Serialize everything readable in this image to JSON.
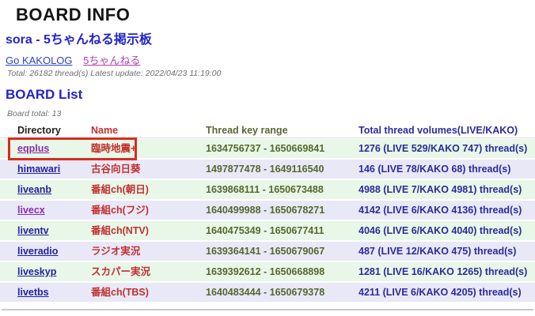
{
  "header": {
    "title": "BOARD INFO",
    "subtitle": "sora - 5ちゃんねる掲示板",
    "links": [
      {
        "label": "Go KAKOLOG"
      },
      {
        "label": "5ちゃんねる"
      }
    ],
    "total_line": "Total: 26182 thread(s) Latest update: 2022/04/23 11:19:00"
  },
  "list": {
    "title": "BOARD List",
    "board_total_line": "Board total: 13"
  },
  "table": {
    "headers": [
      "Directory",
      "Name",
      "Thread key range",
      "Total thread volumes(LIVE/KAKO)"
    ],
    "rows": [
      {
        "directory": "eqplus",
        "name": "臨時地震+",
        "range": "1634756737 - 1650669841",
        "volumes": "1276 (LIVE 529/KAKO 747) thread(s)",
        "visited": true,
        "highlighted": true
      },
      {
        "directory": "himawari",
        "name": "古谷向日葵",
        "range": "1497877478 - 1649116540",
        "volumes": "146 (LIVE 78/KAKO 68) thread(s)",
        "visited": false,
        "highlighted": false
      },
      {
        "directory": "liveanb",
        "name": "番組ch(朝日)",
        "range": "1639868111 - 1650673488",
        "volumes": "4988 (LIVE 7/KAKO 4981) thread(s)",
        "visited": false,
        "highlighted": false
      },
      {
        "directory": "livecx",
        "name": "番組ch(フジ)",
        "range": "1640499988 - 1650678271",
        "volumes": "4142 (LIVE 6/KAKO 4136) thread(s)",
        "visited": true,
        "highlighted": false
      },
      {
        "directory": "liventv",
        "name": "番組ch(NTV)",
        "range": "1640475349 - 1650677411",
        "volumes": "4046 (LIVE 6/KAKO 4040) thread(s)",
        "visited": false,
        "highlighted": false
      },
      {
        "directory": "liveradio",
        "name": "ラジオ実況",
        "range": "1639364141 - 1650679067",
        "volumes": "487 (LIVE 12/KAKO 475) thread(s)",
        "visited": false,
        "highlighted": false
      },
      {
        "directory": "liveskyp",
        "name": "スカパー実況",
        "range": "1639392612 - 1650668898",
        "volumes": "1281 (LIVE 16/KAKO 1265) thread(s)",
        "visited": false,
        "highlighted": false
      },
      {
        "directory": "livetbs",
        "name": "番組ch(TBS)",
        "range": "1640483444 - 1650679378",
        "volumes": "4211 (LIVE 6/KAKO 4205) thread(s)",
        "visited": false,
        "highlighted": false
      }
    ]
  },
  "colors": {
    "heading_blue": "#2424c9",
    "link_blue": "#2b45c4",
    "visited_magenta": "#b13fb1",
    "dir_link_navy": "#22229d",
    "dir_link_visited": "#8b2da8",
    "name_red": "#c22f2f",
    "range_olive": "#55682f",
    "volumes_navy": "#2b2b9b",
    "row_green": "#e8f7e8",
    "row_lavender": "#e8e8f7",
    "highlight_red": "#d92b20",
    "meta_gray": "#6f6f6f"
  }
}
